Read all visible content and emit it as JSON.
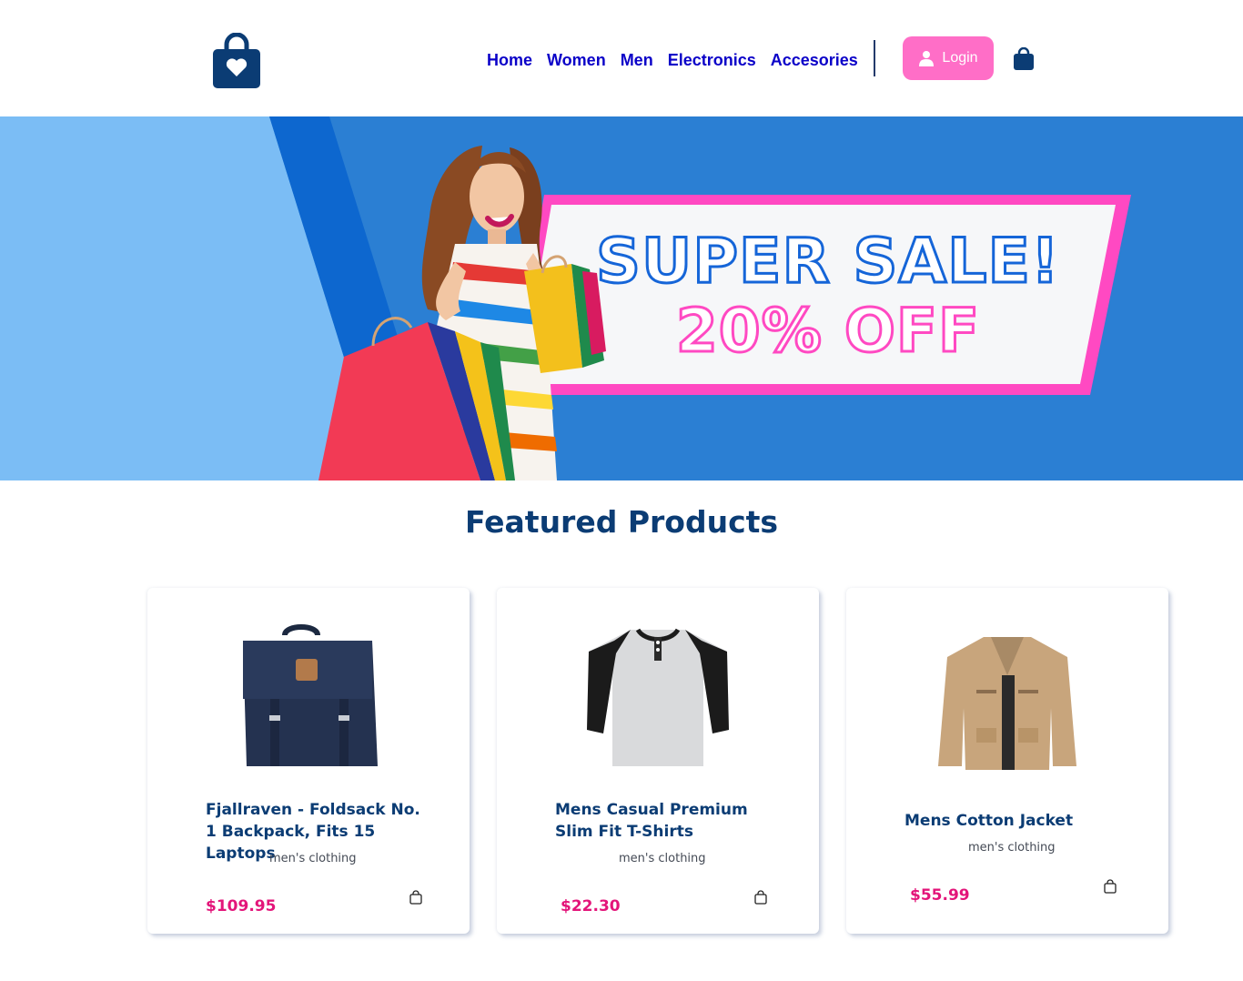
{
  "header": {
    "logo_icon": "shopping-bag-heart-icon",
    "nav": [
      "Home",
      "Women",
      "Men",
      "Electronics",
      "Accesories"
    ],
    "login_label": "Login",
    "cart_icon": "shopping-bag-icon"
  },
  "hero": {
    "line1": "SUPER SALE!",
    "line2": "20% OFF",
    "colors": {
      "light_blue": "#7bbdf5",
      "blue": "#2b7fd3",
      "dark_blue": "#1565d8",
      "pink": "#ff49c2"
    }
  },
  "featured": {
    "title": "Featured Products",
    "products": [
      {
        "title": "Fjallraven - Foldsack No. 1 Backpack, Fits 15 Laptops",
        "category": "men's clothing",
        "price": "$109.95",
        "image": "backpack"
      },
      {
        "title": "Mens Casual Premium Slim Fit T-Shirts",
        "category": "men's clothing",
        "price": "$22.30",
        "image": "t-shirt"
      },
      {
        "title": "Mens Cotton Jacket",
        "category": "men's clothing",
        "price": "$55.99",
        "image": "jacket"
      }
    ]
  },
  "colors": {
    "brand": "#0b3c74",
    "nav": "#0a00c8",
    "accent_pink": "#ff6ec7",
    "price": "#e3157a"
  }
}
